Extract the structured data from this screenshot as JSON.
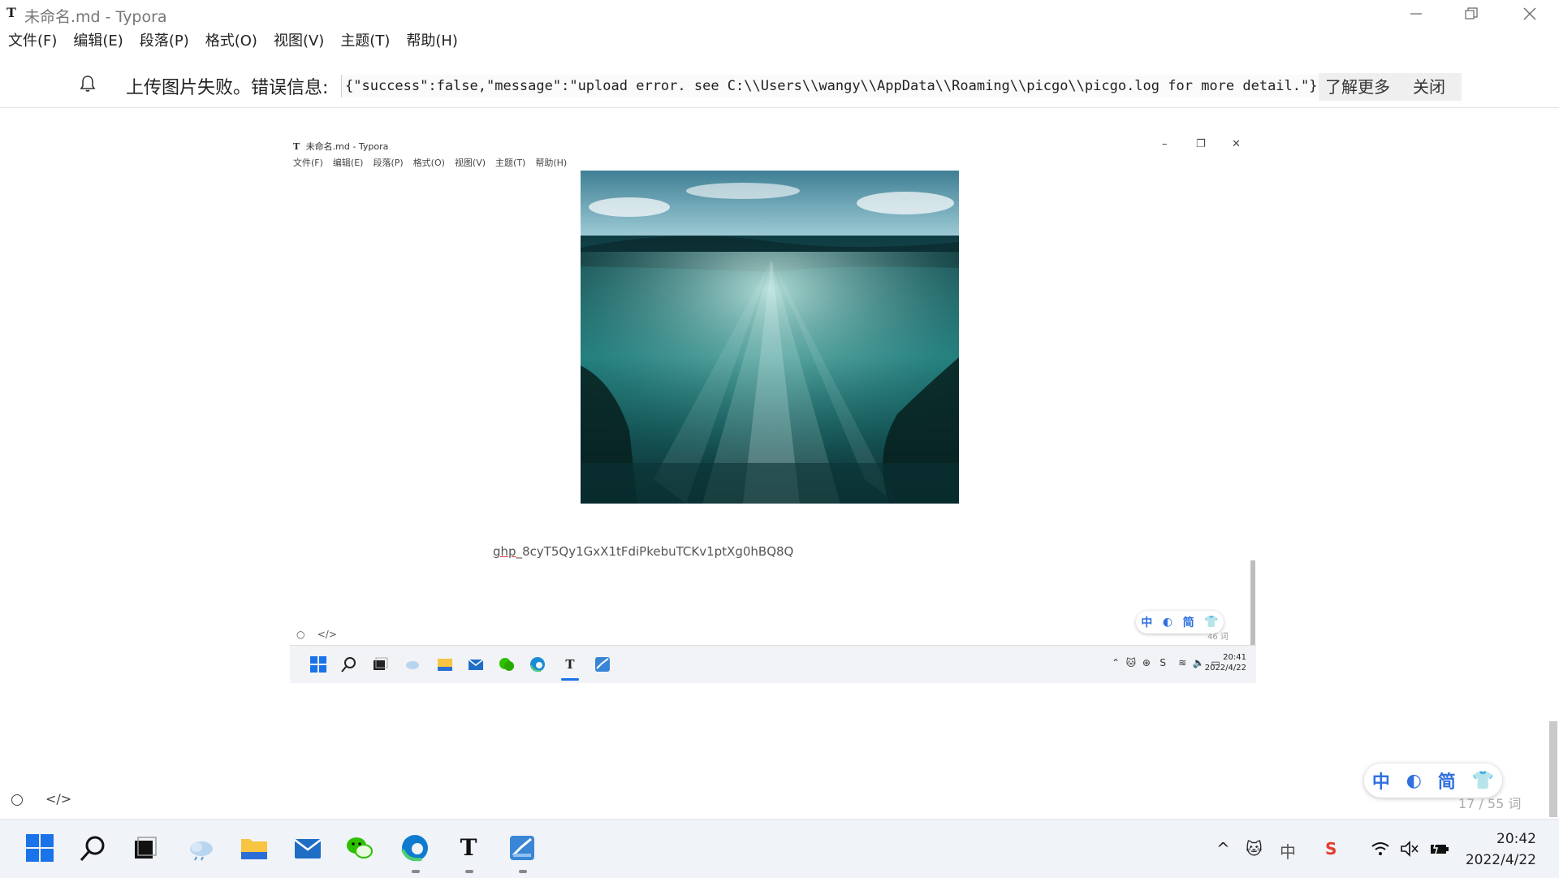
{
  "window": {
    "title": "未命名.md - Typora",
    "app_icon": "T",
    "minimize_icon": "minimize-icon",
    "restore_icon": "restore-icon",
    "close_icon": "close-icon"
  },
  "menu": [
    "文件(F)",
    "编辑(E)",
    "段落(P)",
    "格式(O)",
    "视图(V)",
    "主题(T)",
    "帮助(H)"
  ],
  "notification": {
    "icon": "bell-icon",
    "text": "上传图片失败。错误信息:",
    "message": "{\"success\":false,\"message\":\"upload error. see C:\\\\Users\\\\wangy\\\\AppData\\\\Roaming\\\\picgo\\\\picgo.log for more detail.\"}",
    "learn_more": "了解更多",
    "close": "关闭"
  },
  "embedded": {
    "title": "未命名.md - Typora",
    "app_icon": "T",
    "menu": [
      "文件(F)",
      "编辑(E)",
      "段落(P)",
      "格式(O)",
      "视图(V)",
      "主题(T)",
      "帮助(H)"
    ],
    "image_name": "underwater-ocean-image",
    "token_prefix": "ghp",
    "token_rest": "_8cyT5Qy1GxX1tFdiPkebuTCKv1ptXg0hBQ8Q",
    "ime": [
      "中",
      "◐",
      "简",
      "👕"
    ],
    "word_count": "46 词",
    "time": "20:41",
    "date": "2022/4/22"
  },
  "status": {
    "word_count": "17 / 55 词",
    "ime": [
      "中",
      "◐",
      "简",
      "👕"
    ]
  },
  "taskbar": {
    "icons": [
      "windows-start-icon",
      "search-icon",
      "task-view-icon",
      "weather-icon",
      "file-explorer-icon",
      "mail-icon",
      "wechat-icon",
      "edge-icon",
      "typora-icon",
      "image-app-icon"
    ],
    "tray": [
      "chevron-up-icon",
      "cat-icon",
      "input-method-icon",
      "wps-icon",
      "wifi-icon",
      "volume-muted-icon",
      "battery-icon"
    ],
    "tray_text": [
      "^",
      "中",
      "S"
    ],
    "time": "20:42",
    "date": "2022/4/22"
  }
}
